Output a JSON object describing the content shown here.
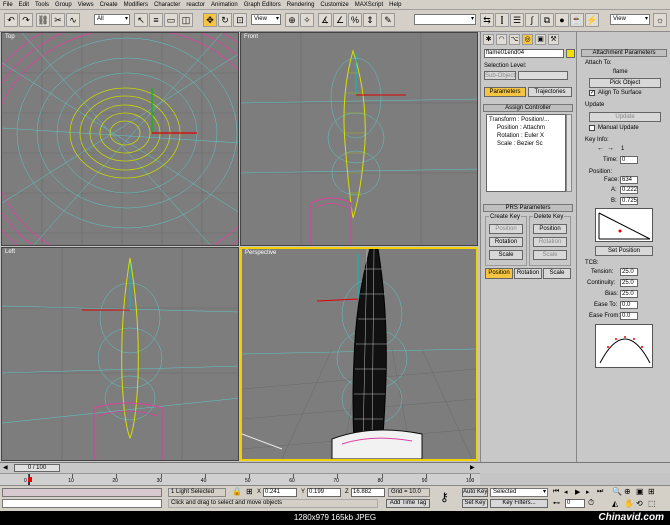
{
  "menu": [
    "File",
    "Edit",
    "Tools",
    "Group",
    "Views",
    "Create",
    "Modifiers",
    "Character",
    "reactor",
    "Animation",
    "Graph Editors",
    "Rendering",
    "Customize",
    "MAXScript",
    "Help"
  ],
  "toolbar": {
    "selection_filter": "All",
    "ref_coord": "View",
    "ref_coord2": "View"
  },
  "viewports": {
    "top": "Top",
    "front": "Front",
    "left": "Left",
    "perspective": "Perspective"
  },
  "panel": {
    "object_name": "flame01end04",
    "selection_level_label": "Selection Level:",
    "sub_object": "Sub-Object",
    "tab_parameters": "Parameters",
    "tab_trajectories": "Trajectories",
    "assign_controller": "Assign Controller",
    "tree": [
      "Transform : Position/...",
      "Position : Attachm",
      "Rotation : Euler X",
      "Scale : Bezier Sc"
    ],
    "prs_header": "PRS Parameters",
    "create_key": "Create Key",
    "delete_key": "Delete Key",
    "create_buttons": [
      "Position",
      "Rotation",
      "Scale"
    ],
    "delete_buttons": [
      "Position",
      "Rotation",
      "Scale"
    ],
    "bottom_buttons": [
      "Position",
      "Rotation",
      "Scale"
    ]
  },
  "attach": {
    "header": "Attachment Parameters",
    "attach_to": "Attach To:",
    "target": "flame",
    "pick_object": "Pick Object",
    "align_surface": "Align To Surface",
    "update_label": "Update",
    "update_btn": "Update",
    "manual_update": "Manual Update",
    "key_info": "Key Info:",
    "key_num": "1",
    "time_label": "Time:",
    "time_val": "0",
    "position_label": "Position:",
    "face_label": "Face:",
    "face_val": "634",
    "a_label": "A:",
    "a_val": "0.222",
    "b_label": "B:",
    "b_val": "0.725",
    "set_position": "Set Position",
    "tcb_label": "TCB:",
    "tension_label": "Tension:",
    "tension_val": "25.0",
    "continuity_label": "Continuity:",
    "continuity_val": "25.0",
    "bias_label": "Bias:",
    "bias_val": "25.0",
    "ease_to_label": "Ease To:",
    "ease_to_val": "0.0",
    "ease_from_label": "Ease From:",
    "ease_from_val": "0.0"
  },
  "time": {
    "slider": "0 / 100",
    "ticks": [
      "0",
      "10",
      "20",
      "30",
      "40",
      "50",
      "60",
      "70",
      "80",
      "90",
      "100"
    ]
  },
  "status": {
    "selected": "1 Light Selected",
    "hint": "Click and drag to select and move objects",
    "x_label": "X",
    "x_val": "0.241",
    "y_label": "Y",
    "y_val": "0.199",
    "z_label": "Z",
    "z_val": "16.882",
    "grid": "Grid = 10.0",
    "add_time_tag": "Add Time Tag",
    "auto_key": "Auto Key",
    "selected_dd": "Selected",
    "set_key": "Set Key",
    "key_filters": "Key Filters...",
    "frame": "0"
  },
  "footer": {
    "info": "1280x979  165kb  JPEG",
    "watermark": "Chinavid.com"
  }
}
